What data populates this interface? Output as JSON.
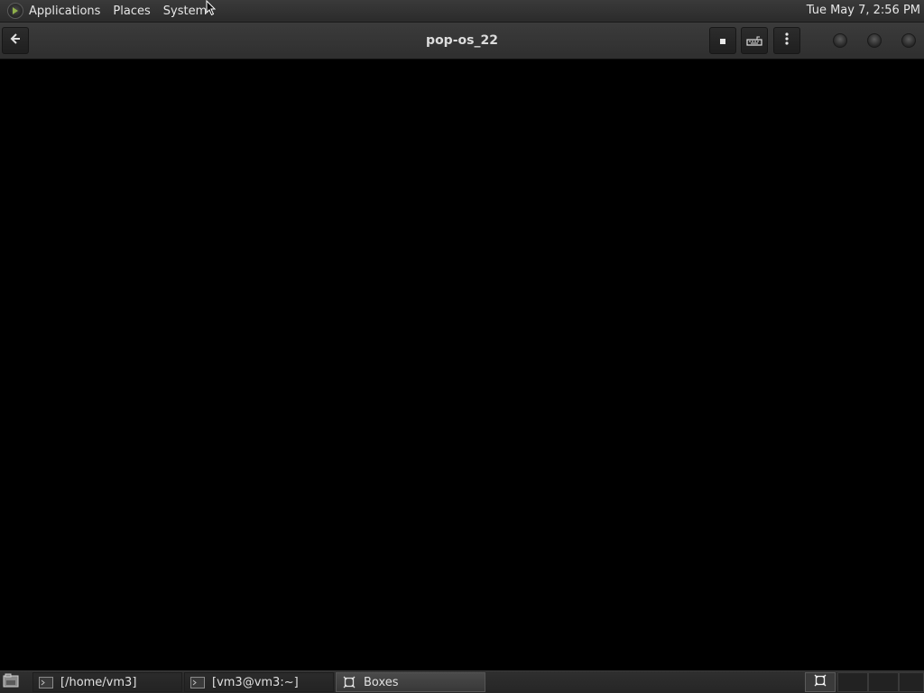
{
  "top_panel": {
    "menus": [
      "Applications",
      "Places",
      "System"
    ],
    "clock": "Tue May 7,  2:56 PM"
  },
  "headerbar": {
    "title": "pop-os_22",
    "icons": [
      "back-arrow-icon",
      "stop-icon",
      "keyboard-icon",
      "kebab-menu-icon"
    ]
  },
  "taskbar": {
    "tasks": [
      {
        "label": "[/home/vm3]",
        "icon": "terminal-icon",
        "active": false
      },
      {
        "label": "[vm3@vm3:~]",
        "icon": "terminal-icon",
        "active": false
      },
      {
        "label": "Boxes",
        "icon": "boxes-icon",
        "active": true
      }
    ]
  },
  "colors": {
    "panel": "#2f2f2f",
    "display": "#000000",
    "text": "#e6e6e6"
  }
}
